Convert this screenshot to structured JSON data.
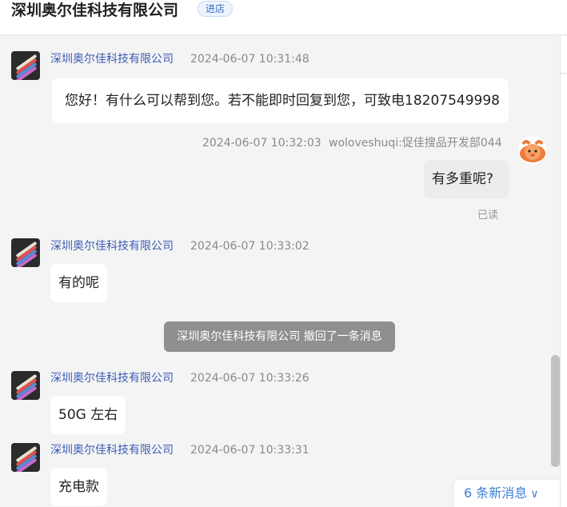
{
  "header": {
    "shop_name": "深圳奥尔佳科技有限公司",
    "enter_label": "进店"
  },
  "messages": [
    {
      "sender": "深圳奥尔佳科技有限公司",
      "time": "2024-06-07 10:31:48",
      "text": "您好！有什么可以帮到您。若不能即时回复到您，可致电18207549998"
    },
    {
      "sender": "woloveshuqi:促佳搜品开发部044",
      "time": "2024-06-07 10:32:03",
      "text": "有多重呢?",
      "status": "已读"
    },
    {
      "sender": "深圳奥尔佳科技有限公司",
      "time": "2024-06-07 10:33:02",
      "text": "有的呢"
    },
    {
      "sender": "深圳奥尔佳科技有限公司",
      "time": "2024-06-07 10:33:26",
      "text": "50G 左右"
    },
    {
      "sender": "深圳奥尔佳科技有限公司",
      "time": "2024-06-07 10:33:31",
      "text": "充电款"
    }
  ],
  "system_notice": "深圳奥尔佳科技有限公司 撤回了一条消息",
  "new_messages": {
    "label": "6 条新消息",
    "icon": "chevron-down-icon"
  },
  "colors": {
    "name_blue": "#3b5bb5",
    "link_blue": "#3d7fd4",
    "notice_gray": "#8f8f8f"
  }
}
